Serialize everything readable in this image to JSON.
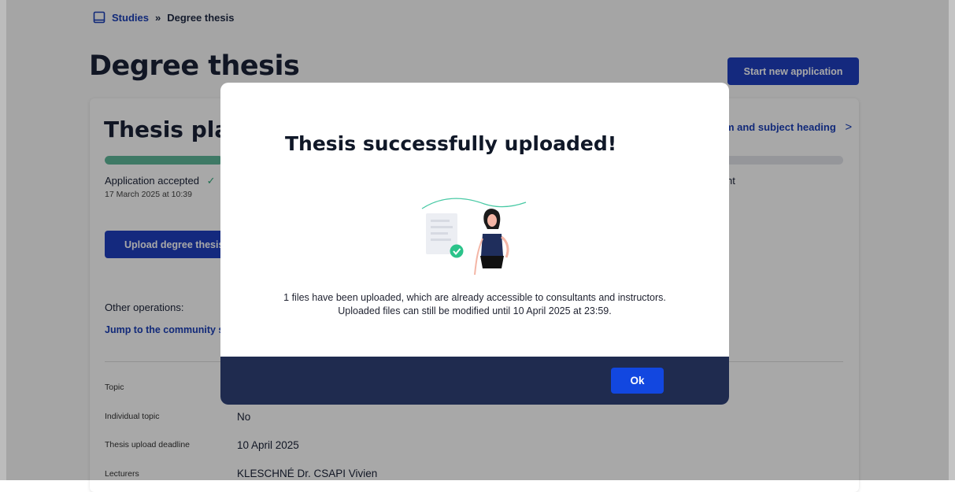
{
  "breadcrumb": {
    "root": "Studies",
    "separator": "»",
    "current": "Degree thesis"
  },
  "page": {
    "title": "Degree thesis",
    "start_button": "Start new application"
  },
  "card": {
    "title": "Thesis plan",
    "link_label": "Form and subject heading",
    "progress_fraction": 0.16,
    "status": "Application accepted",
    "status_date": "17 March 2025 at 10:39",
    "side_status": "ment",
    "upload_button": "Upload degree thesis",
    "other_ops_label": "Other operations:",
    "community_link": "Jump to the community space",
    "rows": [
      {
        "label": "Topic",
        "value": ""
      },
      {
        "label": "Individual topic",
        "value": "No"
      },
      {
        "label": "Thesis upload deadline",
        "value": "10 April 2025"
      },
      {
        "label": "Lecturers",
        "value": "KLESCHNÉ Dr. CSAPI Vivien"
      }
    ]
  },
  "modal": {
    "title": "Thesis successfully uploaded!",
    "line1": "1 files have been uploaded, which are already accessible to consultants and instructors.",
    "line2": "Uploaded files can still be modified until 10 April 2025 at 23:59.",
    "ok_label": "Ok"
  },
  "colors": {
    "primary": "#1f3fbf",
    "link": "#1a3fb8",
    "success": "#2ea87a",
    "footer": "#1f2b4f",
    "ok_button": "#1247e0"
  }
}
